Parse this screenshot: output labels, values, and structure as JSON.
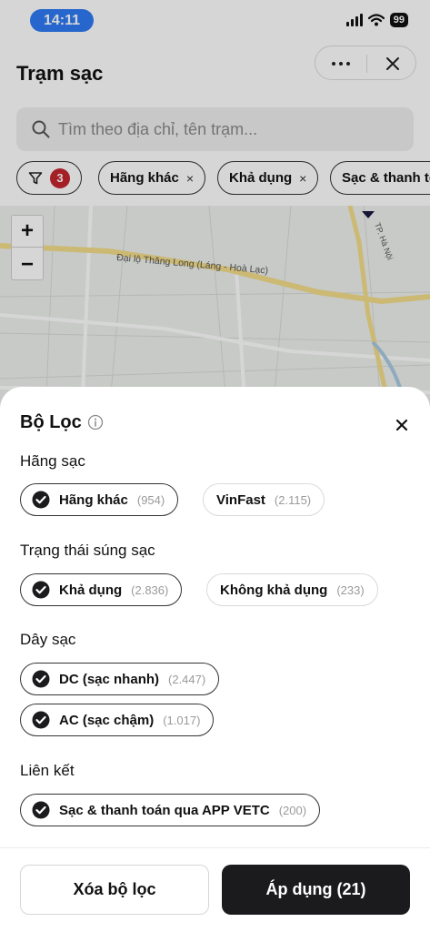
{
  "status_bar": {
    "time": "14:11",
    "battery": "99"
  },
  "header": {
    "title": "Trạm sạc"
  },
  "search": {
    "placeholder": "Tìm theo địa chỉ, tên trạm..."
  },
  "chips": {
    "filter_count": "3",
    "items": [
      {
        "label": "Hãng khác",
        "close": "×"
      },
      {
        "label": "Khả dụng",
        "close": "×"
      },
      {
        "label": "Sạc & thanh toán"
      }
    ]
  },
  "map": {
    "zoom_in": "+",
    "zoom_out": "−",
    "road_label": "Đại lộ Thăng Long (Láng - Hoà Lạc)",
    "area_label": "TP. Hà Nội"
  },
  "sheet": {
    "title": "Bộ Lọc",
    "close": "×",
    "sections": [
      {
        "label": "Hãng sạc",
        "options": [
          {
            "label": "Hãng khác",
            "count": "(954)",
            "selected": true
          },
          {
            "label": "VinFast",
            "count": "(2.115)",
            "selected": false
          }
        ]
      },
      {
        "label": "Trạng thái súng sạc",
        "options": [
          {
            "label": "Khả dụng",
            "count": "(2.836)",
            "selected": true
          },
          {
            "label": "Không khả dụng",
            "count": "(233)",
            "selected": false
          }
        ]
      },
      {
        "label": "Dây sạc",
        "options": [
          {
            "label": "DC (sạc nhanh)",
            "count": "(2.447)",
            "selected": true
          },
          {
            "label": "AC (sạc chậm)",
            "count": "(1.017)",
            "selected": true
          }
        ]
      },
      {
        "label": "Liên kết",
        "options": [
          {
            "label": "Sạc & thanh toán qua APP VETC",
            "count": "(200)",
            "selected": true
          }
        ]
      }
    ]
  },
  "footer": {
    "clear_label": "Xóa bộ lọc",
    "apply_label": "Áp dụng (21)"
  },
  "colors": {
    "accent_dark": "#1b1b1d",
    "badge_red": "#c4262e",
    "time_pill": "#2f7bf5"
  }
}
